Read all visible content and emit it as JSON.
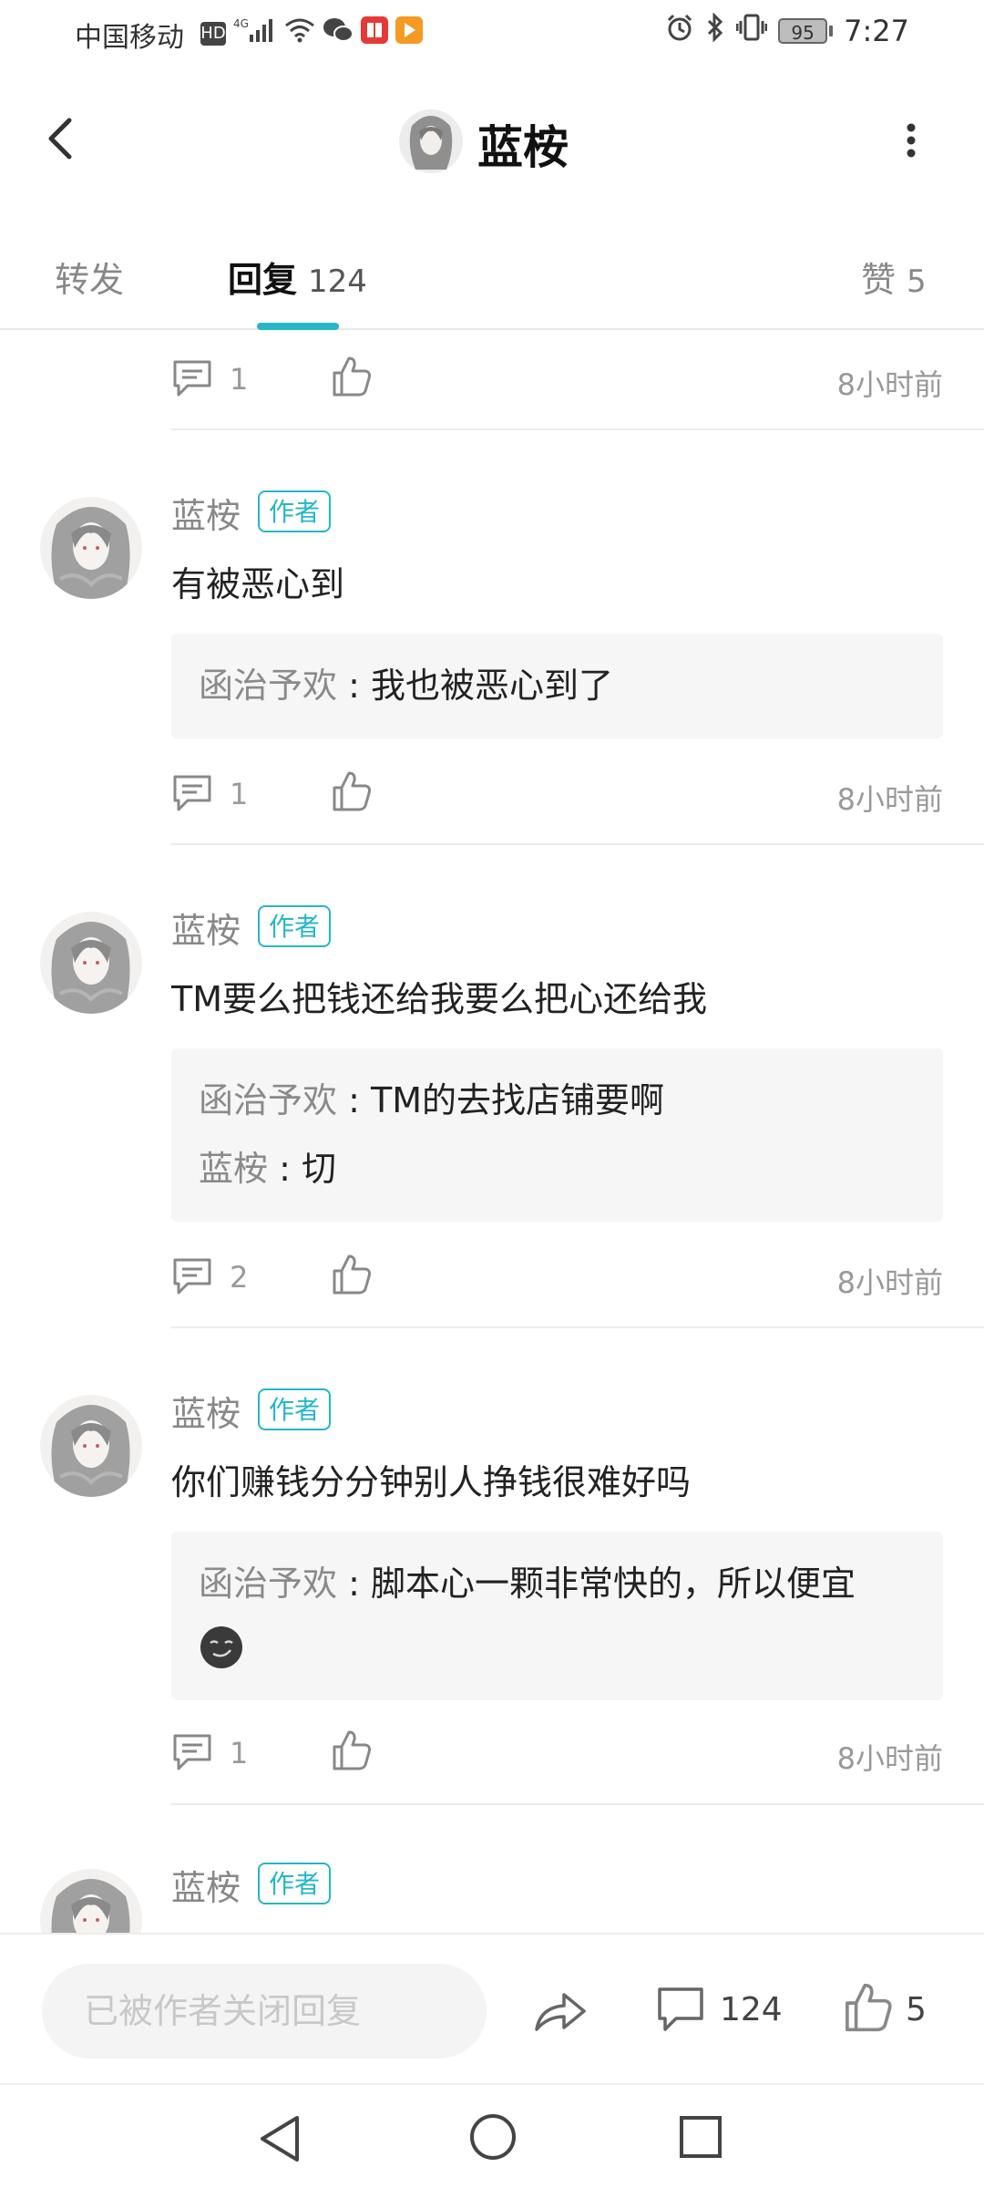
{
  "status_bar": {
    "carrier": "中国移动",
    "hd_badge": "HD",
    "network": "4G",
    "battery": "95",
    "time": "7:27",
    "icons": [
      "hd-icon",
      "signal-icon",
      "wifi-icon",
      "wechat-icon",
      "book-app-icon",
      "video-app-icon",
      "alarm-icon",
      "bluetooth-icon",
      "vibrate-icon",
      "battery-icon"
    ]
  },
  "header": {
    "title": "蓝桉",
    "back_icon": "back-arrow-icon",
    "more_icon": "more-vertical-icon"
  },
  "tabs": [
    {
      "label": "转发",
      "count": ""
    },
    {
      "label": "回复",
      "count": "124",
      "active": true
    },
    {
      "label": "赞",
      "count": "5"
    }
  ],
  "accent_color": "#26b6c6",
  "top_action_row": {
    "reply_count": "1",
    "time": "8小时前"
  },
  "comments": [
    {
      "name": "蓝桉",
      "badge": "作者",
      "text": "有被恶心到",
      "replies": [
        {
          "who": "函治予欢",
          "sep": " : ",
          "text": "我也被恶心到了"
        }
      ],
      "reply_count": "1",
      "time": "8小时前"
    },
    {
      "name": "蓝桉",
      "badge": "作者",
      "text": "TM要么把钱还给我要么把心还给我",
      "replies": [
        {
          "who": "函治予欢",
          "sep": " : ",
          "text": "TM的去找店铺要啊"
        },
        {
          "who": "蓝桉",
          "sep": " : ",
          "text": "切"
        }
      ],
      "reply_count": "2",
      "time": "8小时前"
    },
    {
      "name": "蓝桉",
      "badge": "作者",
      "text": "你们赚钱分分钟别人挣钱很难好吗",
      "replies": [
        {
          "who": "函治予欢",
          "sep": " : ",
          "text": "脚本心一颗非常快的，所以便宜",
          "emoji": "smirk-emoji-icon"
        }
      ],
      "reply_count": "1",
      "time": "8小时前"
    },
    {
      "name": "蓝桉",
      "badge": "作者"
    }
  ],
  "bottom_bar": {
    "reply_placeholder": "已被作者关闭回复",
    "comment_count": "124",
    "like_count": "5"
  },
  "nav_bar": {
    "icons": [
      "nav-back-icon",
      "nav-home-icon",
      "nav-recents-icon"
    ]
  }
}
